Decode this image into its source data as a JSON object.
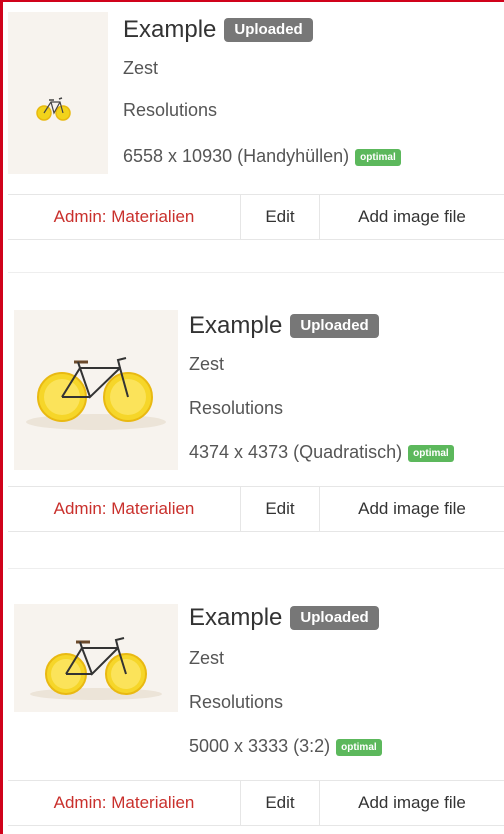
{
  "items": [
    {
      "title": "Example",
      "status_badge": "Uploaded",
      "subtitle": "Zest",
      "resolutions_label": "Resolutions",
      "resolution": "6558 x 10930 (Handyhüllen)",
      "quality_badge": "optimal",
      "thumbnail": "bicycle-lemon-wheels-image",
      "buttons": {
        "admin": "Admin: Materialien",
        "edit": "Edit",
        "add": "Add image file"
      }
    },
    {
      "title": "Example",
      "status_badge": "Uploaded",
      "subtitle": "Zest",
      "resolutions_label": "Resolutions",
      "resolution": "4374 x 4373 (Quadratisch)",
      "quality_badge": "optimal",
      "thumbnail": "bicycle-lemon-wheels-image",
      "buttons": {
        "admin": "Admin: Materialien",
        "edit": "Edit",
        "add": "Add image file"
      }
    },
    {
      "title": "Example",
      "status_badge": "Uploaded",
      "subtitle": "Zest",
      "resolutions_label": "Resolutions",
      "resolution": "5000 x 3333 (3:2)",
      "quality_badge": "optimal",
      "thumbnail": "bicycle-lemon-wheels-image",
      "buttons": {
        "admin": "Admin: Materialien",
        "edit": "Edit",
        "add": "Add image file"
      }
    }
  ],
  "colors": {
    "frame_border": "#d0021b",
    "admin_link": "#c9302c",
    "badge_uploaded": "#777777",
    "badge_optimal": "#5cb85c"
  }
}
